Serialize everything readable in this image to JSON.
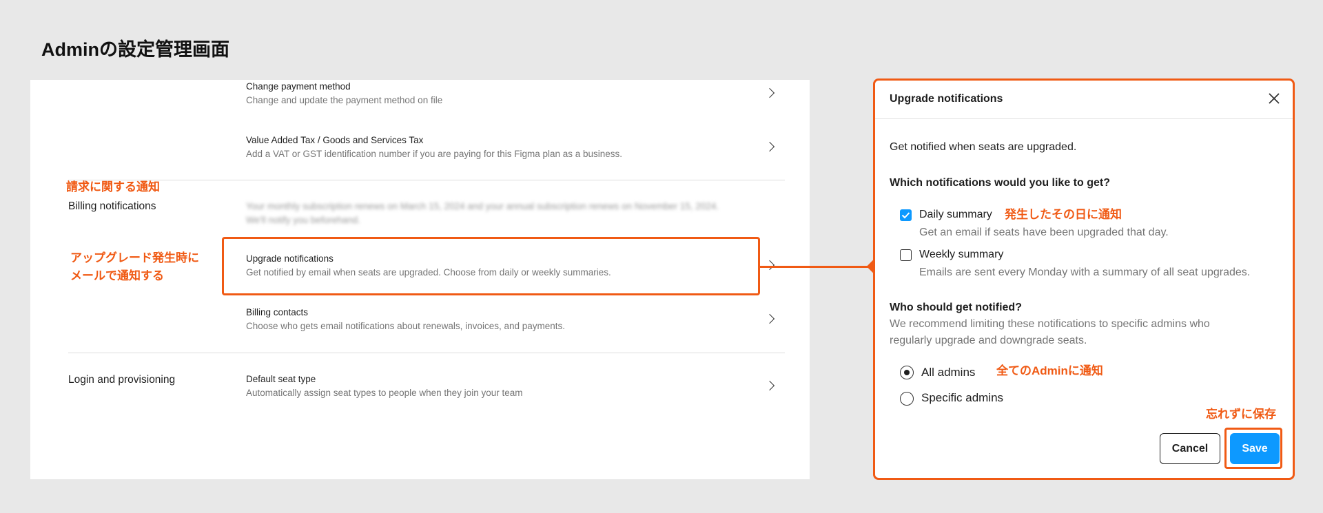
{
  "page_title": "Adminの設定管理画面",
  "settings": {
    "change_payment": {
      "label": "Change payment method",
      "desc": "Change and update the payment method on file"
    },
    "vat": {
      "label": "Value Added Tax / Goods and Services Tax",
      "desc": "Add a VAT or GST identification number if you are paying for this Figma plan as a business."
    },
    "billing_notifications_section": "Billing notifications",
    "blurred_line_1": "Your monthly subscription renews on March 15, 2024 and your annual subscription renews on November 15, 2024.",
    "blurred_line_2": "We'll notify you beforehand.",
    "upgrade_notifications": {
      "label": "Upgrade notifications",
      "desc": "Get notified by email when seats are upgraded. Choose from daily or weekly summaries."
    },
    "billing_contacts": {
      "label": "Billing contacts",
      "desc": "Choose who gets email notifications about renewals, invoices, and payments."
    },
    "login_section": "Login and provisioning",
    "default_seat": {
      "label": "Default seat type",
      "desc": "Automatically assign seat types to people when they join your team"
    }
  },
  "annotations": {
    "billing_note": "請求に関する通知",
    "upgrade_note_line1": "アップグレード発生時に",
    "upgrade_note_line2": "メールで通知する",
    "daily_note": "発生したその日に通知",
    "all_admins_note": "全てのAdminに通知",
    "save_note": "忘れずに保存"
  },
  "modal": {
    "title": "Upgrade notifications",
    "intro": "Get notified when seats are upgraded.",
    "question": "Which notifications would you like to get?",
    "daily": {
      "label": "Daily summary",
      "desc": "Get an email if seats have been upgraded that day.",
      "checked": true
    },
    "weekly": {
      "label": "Weekly summary",
      "desc": "Emails are sent every Monday with a summary of all seat upgrades.",
      "checked": false
    },
    "who_heading": "Who should get notified?",
    "who_desc_line1": "We recommend limiting these notifications to specific admins who",
    "who_desc_line2": "regularly upgrade and downgrade seats.",
    "all_admins": {
      "label": "All admins",
      "selected": true
    },
    "specific_admins": {
      "label": "Specific admins",
      "selected": false
    },
    "cancel_label": "Cancel",
    "save_label": "Save"
  },
  "colors": {
    "accent_orange": "#f05a14",
    "primary_blue": "#0d99ff"
  }
}
